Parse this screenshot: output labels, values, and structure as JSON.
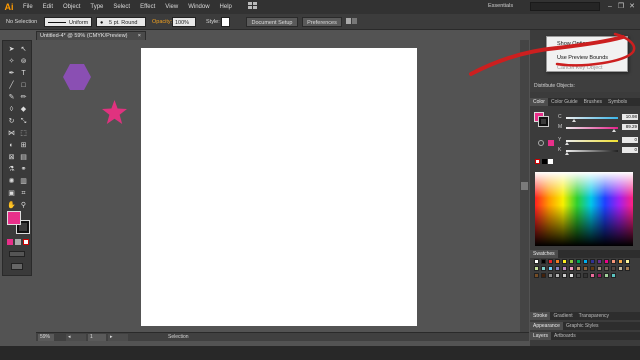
{
  "app": {
    "logo": "Ai",
    "menu": [
      "File",
      "Edit",
      "Object",
      "Type",
      "Select",
      "Effect",
      "View",
      "Window",
      "Help"
    ],
    "workspace": "Essentials",
    "window_buttons": [
      "–",
      "❐",
      "✕"
    ]
  },
  "control_bar": {
    "selection_label": "No Selection",
    "stroke_profile": "Uniform",
    "brush": "5 pt. Round",
    "opacity_label": "Opacity:",
    "opacity_value": "100%",
    "style_label": "Style:",
    "document_setup": "Document Setup",
    "preferences": "Preferences"
  },
  "document": {
    "tab_title": "Untitled-4* @ 59% (CMYK/Preview)",
    "tab_close": "×"
  },
  "status_bar": {
    "zoom": "59%",
    "artboard_number": "1",
    "status_text": "Selection"
  },
  "popup_menu": {
    "items": [
      "Show Options",
      "Use Preview Bounds",
      "Cancel Key Object"
    ]
  },
  "panels": {
    "align": {
      "distribute_label": "Distribute Objects:"
    },
    "color_tabs": [
      "Color",
      "Color Guide",
      "Brushes",
      "Symbols"
    ],
    "cmyk": [
      {
        "label": "C",
        "value": "10.98",
        "color": "#3ab4e8"
      },
      {
        "label": "M",
        "value": "89.29",
        "color": "#e5208a"
      },
      {
        "label": "Y",
        "value": "0",
        "color": "#f0e030"
      },
      {
        "label": "K",
        "value": "0",
        "color": "#222222"
      }
    ],
    "swatches_tab": "Swatches",
    "swatch_colors": [
      "#ffffff",
      "#000000",
      "#e8232a",
      "#f47a20",
      "#fcee21",
      "#8cc63f",
      "#00a651",
      "#00aeef",
      "#2e3192",
      "#662d91",
      "#ec008c",
      "#f7977a",
      "#fbad4a",
      "#fff799",
      "#c4df9b",
      "#7accc8",
      "#6dcff6",
      "#8781bd",
      "#bd8cbf",
      "#f49ac1",
      "#c69c6d",
      "#8c6239",
      "#603813",
      "#998675",
      "#736357",
      "#534741",
      "#c2b59b",
      "#a67c52",
      "#754c24",
      "#42210b",
      "#898989",
      "#b3b3b3",
      "#cccccc",
      "#e6e6e6",
      "#4d4d4d",
      "#333333",
      "#ec6d9d",
      "#9e1f63",
      "#a3d39c",
      "#5bc4c0"
    ],
    "bottom_tabs_1": [
      "Stroke",
      "Gradient",
      "Transparency"
    ],
    "bottom_tabs_2": [
      "Appearance",
      "Graphic Styles"
    ],
    "bottom_tabs_3": [
      "Layers",
      "Artboards"
    ]
  },
  "colors": {
    "fill": "#e8308a",
    "hexagon": "#8a4fb3",
    "star": "#e0327f",
    "annotation": "#cc1f1f",
    "accent": "#ff9a00"
  }
}
